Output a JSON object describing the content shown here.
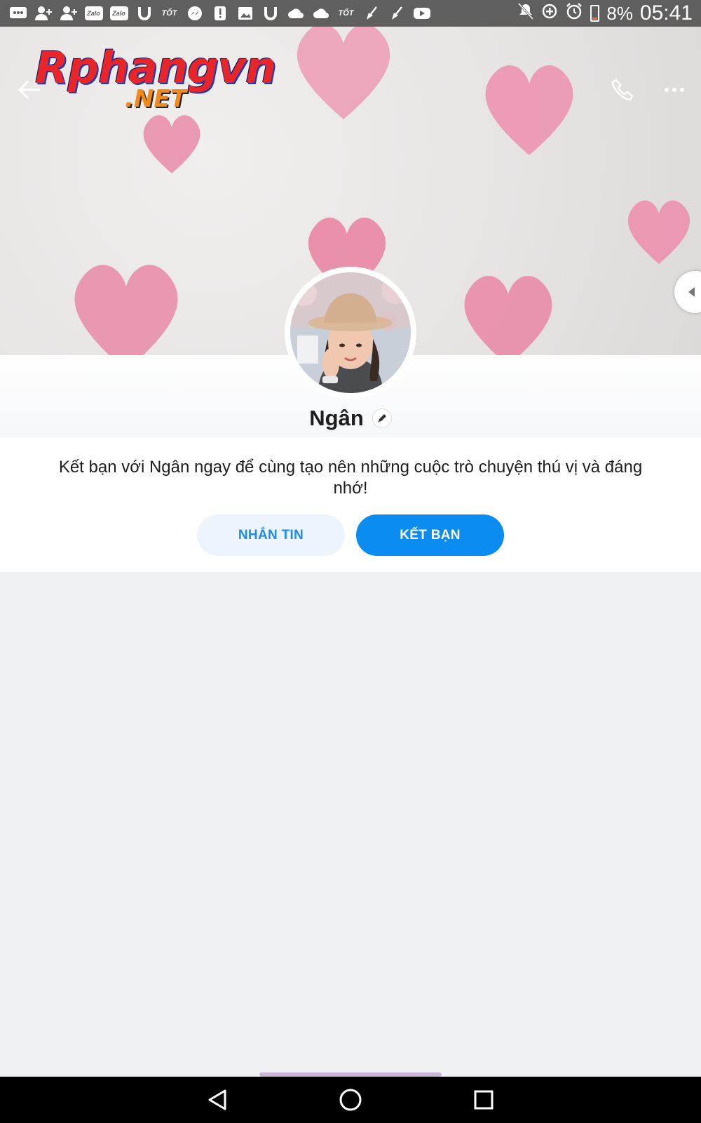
{
  "status_bar": {
    "notification_icons": [
      "messages-icon",
      "add-friend-icon",
      "add-friend-icon",
      "zalo-icon",
      "zalo-icon",
      "u-icon",
      "tot-icon",
      "messenger-icon",
      "alert-icon",
      "gallery-icon",
      "u-icon",
      "cloud-icon",
      "cloud-icon",
      "tot-icon",
      "broom-icon",
      "broom-icon",
      "youtube-icon"
    ],
    "zalo_label": "Zalo",
    "tot_label": "TỐT",
    "battery": "8%",
    "time": "05:41",
    "battery_color": "#ff6a3a"
  },
  "watermark": {
    "main": "Rphangvn",
    "sub": ".NET"
  },
  "profile": {
    "name": "Ngân",
    "invite_text": "Kết bạn với Ngân ngay để cùng tạo nên những cuộc trò chuyện thú vị và đáng nhớ!",
    "message_button": "NHẮN TIN",
    "add_friend_button": "KẾT BẠN"
  },
  "colors": {
    "accent": "#0a8cf0",
    "secondary_button_bg": "#eef4fb",
    "page_bg": "#eff1f5"
  }
}
